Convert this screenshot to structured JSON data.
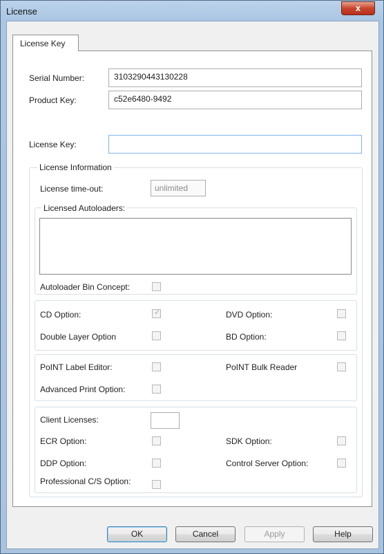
{
  "window": {
    "title": "License",
    "close_label": "x"
  },
  "tabs": [
    {
      "label": "License Key"
    }
  ],
  "fields": {
    "serial_number": {
      "label": "Serial Number:",
      "value": "3103290443130228"
    },
    "product_key": {
      "label": "Product Key:",
      "value": "c52e6480-9492"
    },
    "license_key": {
      "label": "License Key:",
      "value": ""
    }
  },
  "license_info": {
    "title": "License Information",
    "timeout": {
      "label": "License time-out:",
      "value": "unlimited"
    },
    "autoloaders": {
      "title": "Licensed Autoloaders:",
      "items": []
    },
    "bin_concept": {
      "label": "Autoloader Bin Concept:",
      "checked": false
    }
  },
  "media_options": {
    "cd": {
      "label": "CD Option:",
      "checked": true
    },
    "dvd": {
      "label": "DVD Option:",
      "checked": false
    },
    "double_layer": {
      "label": "Double Layer Option",
      "checked": false
    },
    "bd": {
      "label": "BD Option:",
      "checked": false
    }
  },
  "point_options": {
    "label_editor": {
      "label": "PoINT Label Editor:",
      "checked": false
    },
    "bulk_reader": {
      "label": "PoINT Bulk Reader",
      "checked": false
    },
    "advanced_print": {
      "label": "Advanced Print Option:",
      "checked": false
    }
  },
  "client_options": {
    "client_licenses": {
      "label": "Client Licenses:",
      "value": ""
    },
    "ecr": {
      "label": "ECR Option:",
      "checked": false
    },
    "sdk": {
      "label": "SDK Option:",
      "checked": false
    },
    "ddp": {
      "label": "DDP Option:",
      "checked": false
    },
    "control_server": {
      "label": "Control Server Option:",
      "checked": false
    },
    "professional_cs": {
      "label": "Professional C/S Option:",
      "checked": false
    }
  },
  "buttons": {
    "ok": "OK",
    "cancel": "Cancel",
    "apply": "Apply",
    "help": "Help"
  }
}
